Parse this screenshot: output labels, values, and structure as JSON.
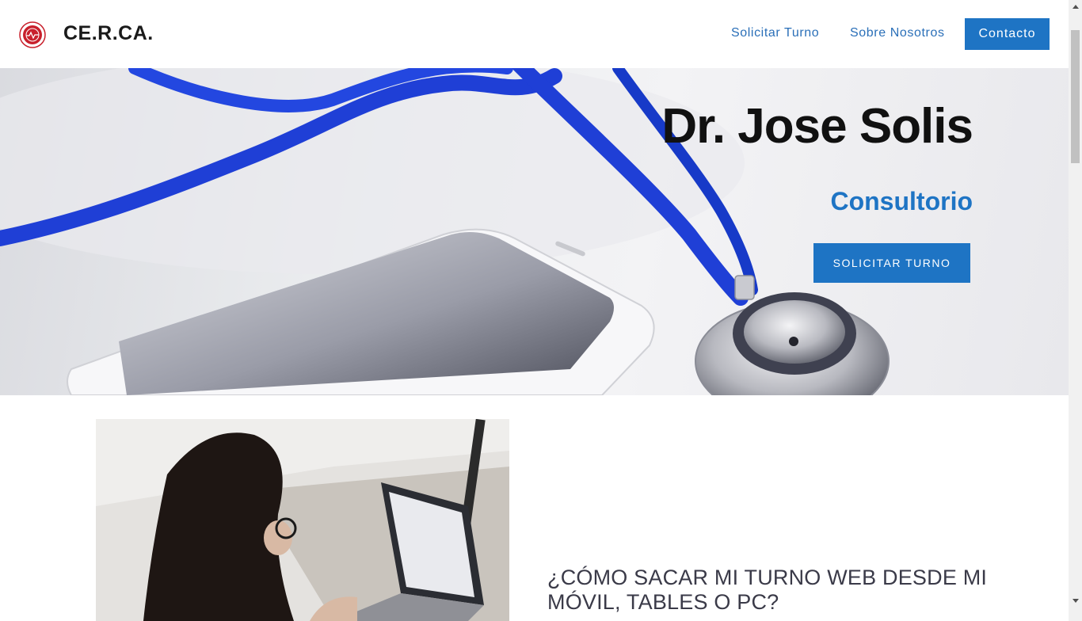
{
  "header": {
    "brand": "CE.R.CA.",
    "nav": [
      {
        "label": "Solicitar Turno"
      },
      {
        "label": "Sobre Nosotros"
      }
    ],
    "contact_label": "Contacto"
  },
  "hero": {
    "title": "Dr. Jose Solis",
    "subtitle": "Consultorio",
    "button_label": "SOLICITAR TURNO"
  },
  "article": {
    "title": "¿CÓMO SACAR MI TURNO WEB DESDE MI MÓVIL, TABLES O PC?"
  },
  "icons": {
    "logo": "medical-seal-icon",
    "scroll_up": "chevron-up-icon",
    "scroll_down": "chevron-down-icon"
  },
  "colors": {
    "accent": "#1e74c4",
    "brand_text": "#1a1a1a",
    "logo_red": "#c8202c"
  }
}
